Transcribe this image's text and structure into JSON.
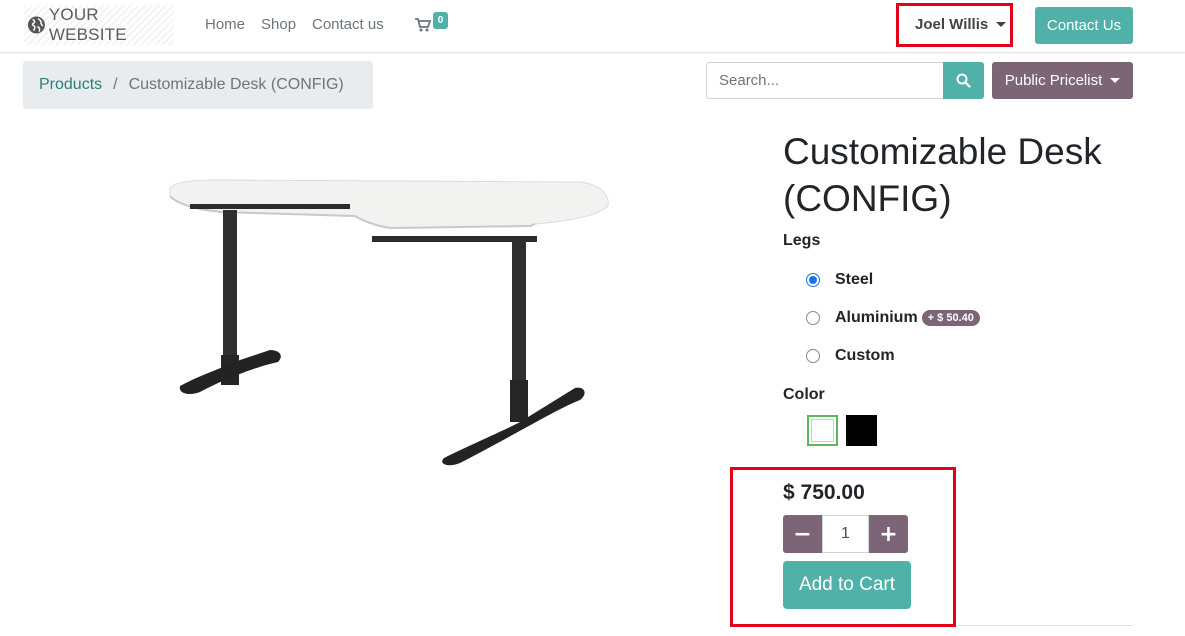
{
  "header": {
    "logo_text": "YOUR WEBSITE",
    "nav": [
      {
        "label": "Home"
      },
      {
        "label": "Shop"
      },
      {
        "label": "Contact us"
      }
    ],
    "cart_count": "0",
    "user_name": "Joel Willis",
    "contact_button": "Contact Us"
  },
  "breadcrumb": {
    "link": "Products",
    "separator": "/",
    "current": "Customizable Desk (CONFIG)"
  },
  "search": {
    "placeholder": "Search..."
  },
  "pricelist": {
    "label": "Public Pricelist"
  },
  "product": {
    "title": "Customizable Desk (CONFIG)",
    "legs": {
      "label": "Legs",
      "options": [
        {
          "label": "Steel",
          "selected": true
        },
        {
          "label": "Aluminium",
          "extra": "+ $ 50.40",
          "selected": false
        },
        {
          "label": "Custom",
          "selected": false
        }
      ]
    },
    "color": {
      "label": "Color",
      "options": [
        {
          "name": "white",
          "hex": "#ffffff",
          "selected": true
        },
        {
          "name": "black",
          "hex": "#000000",
          "selected": false
        }
      ]
    },
    "price": "$ 750.00",
    "quantity": "1",
    "add_to_cart": "Add to Cart"
  },
  "colors": {
    "primary": "#50b1a9",
    "secondary": "#7c6577",
    "highlight": "#e3001b"
  }
}
